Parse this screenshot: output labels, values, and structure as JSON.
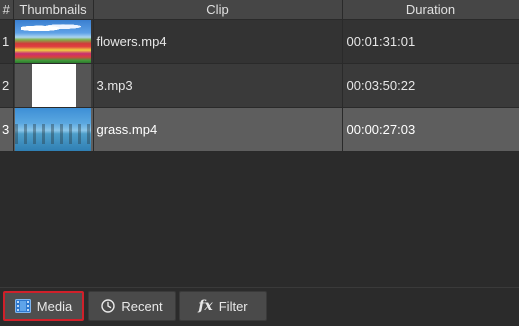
{
  "columns": {
    "num": "#",
    "thumbnails": "Thumbnails",
    "clip": "Clip",
    "duration": "Duration"
  },
  "rows": [
    {
      "num": "1",
      "clip": "flowers.mp4",
      "duration": "00:01:31:01",
      "thumbnail": "flowers-video-thumbnail",
      "selected": false
    },
    {
      "num": "2",
      "clip": "3.mp3",
      "duration": "00:03:50:22",
      "thumbnail": "audio-file-thumbnail",
      "selected": false
    },
    {
      "num": "3",
      "clip": "grass.mp4",
      "duration": "00:00:27:03",
      "thumbnail": "grass-video-thumbnail",
      "selected": true
    }
  ],
  "tabs": {
    "media": {
      "label": "Media",
      "icon": "film-icon",
      "active": true
    },
    "recent": {
      "label": "Recent",
      "icon": "clock-icon",
      "active": false
    },
    "filter": {
      "label": "Filter",
      "icon": "fx-icon",
      "active": false
    }
  },
  "colors": {
    "background": "#2b2b2b",
    "header": "#464646",
    "selected_row": "#5e5e5e",
    "active_tab_border": "#d0202a",
    "film_icon": "#3f8fe0"
  }
}
